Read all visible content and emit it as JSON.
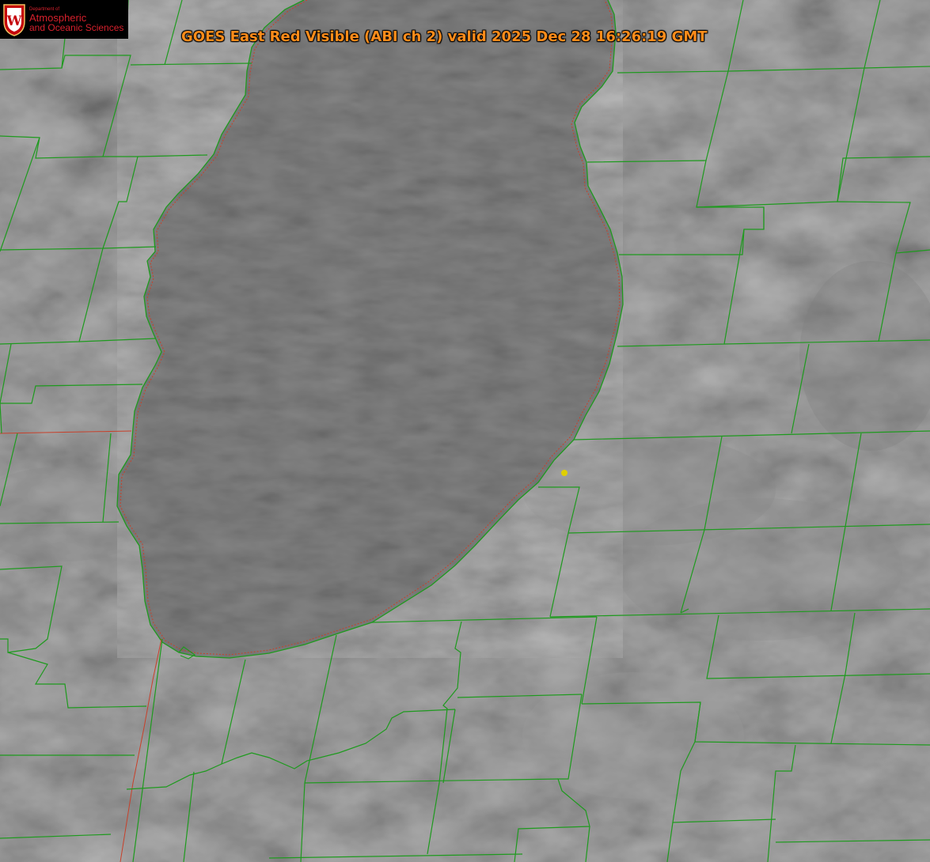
{
  "logo": {
    "department": "Department of",
    "line1": "Atmospheric",
    "line2": "and Oceanic Sciences",
    "crest_letter": "W",
    "crest_color": "#c5050c"
  },
  "title": "GOES East Red Visible (ABI ch 2) valid 2025 Dec 28 16:26:19 GMT",
  "colors": {
    "title": "#ff8c1a",
    "county_lines": "#1e9a1e",
    "state_line": "#c8402a",
    "marker": "#e0d000",
    "lake": "#5d5d5d",
    "land": "#6c6c6c"
  }
}
